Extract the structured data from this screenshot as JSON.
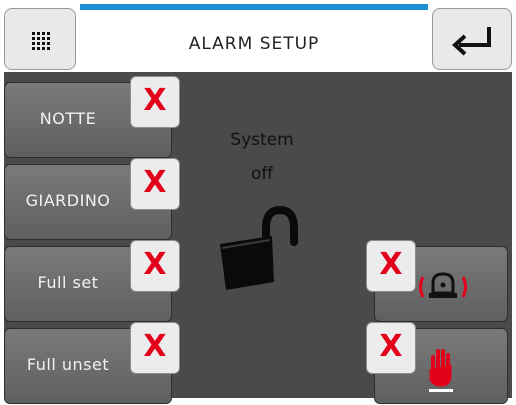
{
  "header": {
    "title": "ALARM SETUP",
    "menu_icon": "grid-menu-icon",
    "back_icon": "return-arrow-icon"
  },
  "status": {
    "line1": "System",
    "line2": "off",
    "icon": "unlocked-padlock-icon"
  },
  "zones": [
    {
      "label": "NOTTE",
      "remove_label": "X"
    },
    {
      "label": "GIARDINO",
      "remove_label": "X"
    },
    {
      "label": "Full set",
      "remove_label": "X"
    },
    {
      "label": "Full unset",
      "remove_label": "X"
    }
  ],
  "functions": [
    {
      "icon": "siren-alarm-icon",
      "remove_label": "X"
    },
    {
      "icon": "hand-stop-icon",
      "remove_label": "X"
    }
  ],
  "colors": {
    "accent": "#1d8fd6",
    "remove_x": "#e3001b",
    "panel_bg": "#4a4a4a"
  }
}
